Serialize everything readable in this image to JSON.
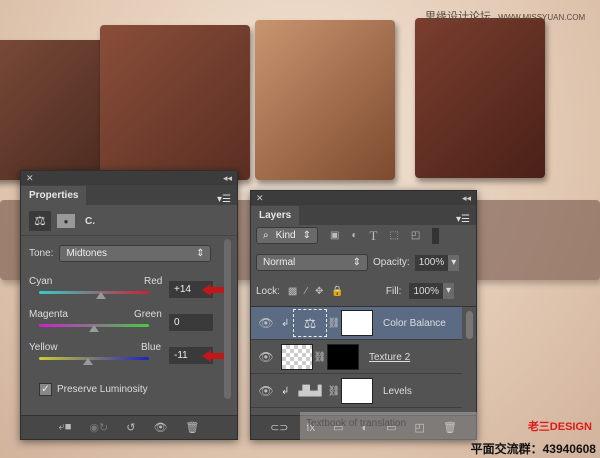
{
  "watermark": {
    "site_cn": "思缘设计论坛",
    "site_url": "WWW.MISSYUAN.COM",
    "brand": "老三DESIGN",
    "group": "平面交流群：43940608",
    "overlay": "Textbook of translation"
  },
  "properties": {
    "title": "Properties",
    "adjustment_label": "C.",
    "tone_label": "Tone:",
    "tone_value": "Midtones",
    "sliders": [
      {
        "left": "Cyan",
        "right": "Red",
        "value": "+14",
        "position": 0.57
      },
      {
        "left": "Magenta",
        "right": "Green",
        "value": "0",
        "position": 0.5
      },
      {
        "left": "Yellow",
        "right": "Blue",
        "value": "-11",
        "position": 0.45
      }
    ],
    "preserve_luminosity": "Preserve Luminosity",
    "preserve_checked": true
  },
  "layers": {
    "title": "Layers",
    "filter_kind": "Kind",
    "blend_mode": "Normal",
    "opacity_label": "Opacity:",
    "opacity_value": "100%",
    "lock_label": "Lock:",
    "fill_label": "Fill:",
    "fill_value": "100%",
    "items": [
      {
        "name": "Color Balance",
        "selected": true
      },
      {
        "name": "Texture 2",
        "selected": false
      },
      {
        "name": "Levels",
        "selected": false
      }
    ]
  },
  "colors": {
    "accent_arrow": "#c01818",
    "selected_layer": "#5b6b84"
  }
}
